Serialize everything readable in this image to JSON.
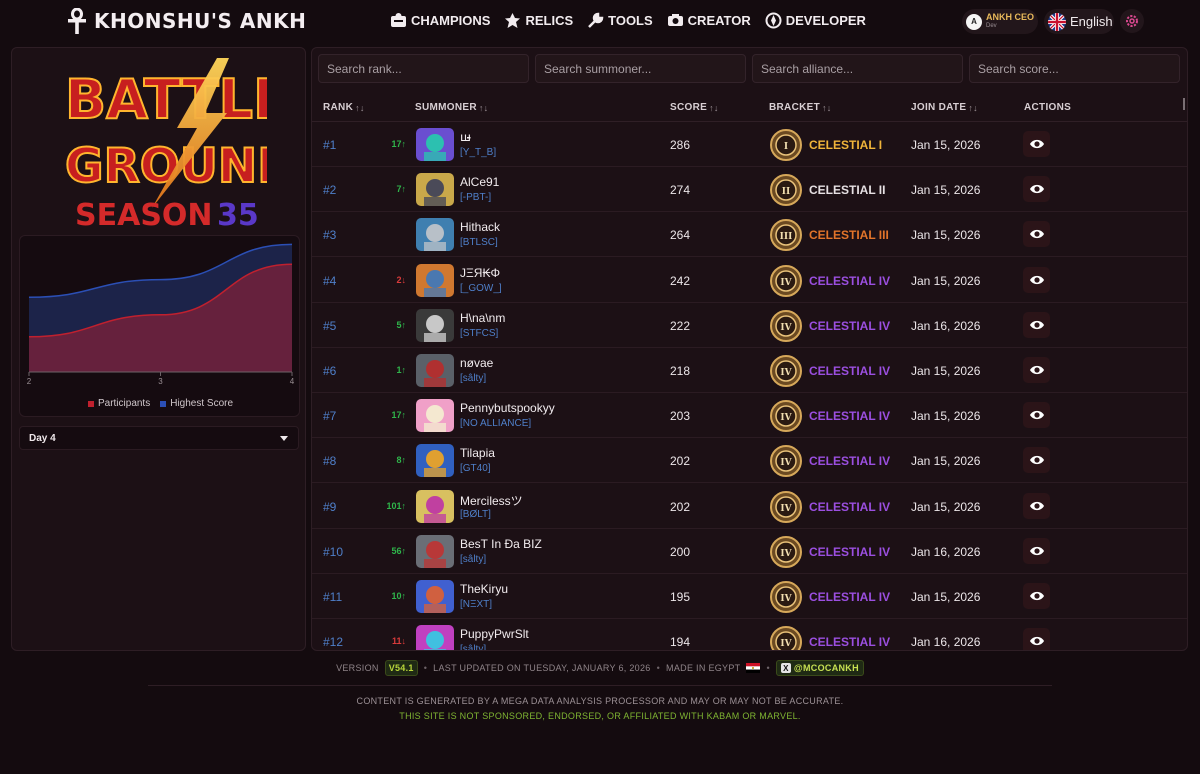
{
  "header": {
    "site_title": "KHONSHU'S ANKH",
    "menu": [
      {
        "label": "CHAMPIONS",
        "icon": "champions-icon"
      },
      {
        "label": "RELICS",
        "icon": "relics-icon"
      },
      {
        "label": "TOOLS",
        "icon": "tools-icon"
      },
      {
        "label": "CREATOR",
        "icon": "creator-icon"
      },
      {
        "label": "DEVELOPER",
        "icon": "developer-icon"
      }
    ],
    "user": {
      "initial": "A",
      "name": "ANKH CEO",
      "role": "Dev"
    },
    "language": "English"
  },
  "sidebar": {
    "logo": {
      "line1": "BATTLE",
      "line2": "GROUNDS",
      "season_word": "SEASON",
      "season_number": "35"
    },
    "day_select": {
      "selected": "Day 4"
    }
  },
  "chart_data": {
    "type": "area",
    "x": [
      2,
      3,
      4
    ],
    "series": [
      {
        "name": "Participants",
        "color": "#c0202e",
        "values": [
          80,
          130,
          245
        ]
      },
      {
        "name": "Highest Score",
        "color": "#2b4fb5",
        "values": [
          170,
          210,
          290
        ]
      }
    ],
    "xlim": [
      2,
      4
    ],
    "ylim": [
      0,
      300
    ],
    "grid": false,
    "legend": "bottom"
  },
  "search": {
    "rank": "Search rank...",
    "summoner": "Search summoner...",
    "alliance": "Search alliance...",
    "score": "Search score..."
  },
  "columns": {
    "rank": "RANK",
    "summoner": "SUMMONER",
    "score": "SCORE",
    "bracket": "BRACKET",
    "join_date": "JOIN DATE",
    "actions": "ACTIONS",
    "sort_glyph": "↑↓"
  },
  "rows": [
    {
      "rank": "#1",
      "delta": "17↑",
      "dir": "up",
      "name": "ꟺ̵̵̵̵̵̵̵̵̵̵̵̵̵̵̵̵̵̵̵̵̵̵̵̵̵̵̵̵̵̵",
      "alliance": "[Y_T_B]",
      "score": "286",
      "bracket": "CELESTIAL I",
      "tier": "I",
      "bracket_color": "#f0b43a",
      "join": "Jan 15, 2026",
      "avatar": [
        "#6a4ed0",
        "#2cc0b0"
      ]
    },
    {
      "rank": "#2",
      "delta": "7↑",
      "dir": "up",
      "name": "AlCe91",
      "alliance": "[-PBT-]",
      "score": "274",
      "bracket": "CELESTIAL II",
      "tier": "II",
      "bracket_color": "#e6e0e3",
      "join": "Jan 15, 2026",
      "avatar": [
        "#c9a84a",
        "#4a4a58"
      ]
    },
    {
      "rank": "#3",
      "delta": "",
      "dir": "up",
      "name": "Hithack",
      "alliance": "[BTLSC]",
      "score": "264",
      "bracket": "CELESTIAL III",
      "tier": "III",
      "bracket_color": "#e2742a",
      "join": "Jan 15, 2026",
      "avatar": [
        "#3f7fb0",
        "#b8c0c8"
      ]
    },
    {
      "rank": "#4",
      "delta": "2↓",
      "dir": "down",
      "name": "JΞЯ₭Φ",
      "alliance": "[_GOW_]",
      "score": "242",
      "bracket": "CELESTIAL IV",
      "tier": "IV",
      "bracket_color": "#9b4fe0",
      "join": "Jan 15, 2026",
      "avatar": [
        "#d07830",
        "#4a78b0"
      ]
    },
    {
      "rank": "#5",
      "delta": "5↑",
      "dir": "up",
      "name": "H\\na\\nm",
      "alliance": "[STFCS]",
      "score": "222",
      "bracket": "CELESTIAL IV",
      "tier": "IV",
      "bracket_color": "#9b4fe0",
      "join": "Jan 16, 2026",
      "avatar": [
        "#3a3a3a",
        "#c8c8c8"
      ]
    },
    {
      "rank": "#6",
      "delta": "1↑",
      "dir": "up",
      "name": "nøvae",
      "alliance": "[sâlty]",
      "score": "218",
      "bracket": "CELESTIAL IV",
      "tier": "IV",
      "bracket_color": "#9b4fe0",
      "join": "Jan 15, 2026",
      "avatar": [
        "#5a6068",
        "#b03030"
      ]
    },
    {
      "rank": "#7",
      "delta": "17↑",
      "dir": "up",
      "name": "Pennybutspookyy",
      "alliance": "[NO ALLIANCE]",
      "score": "203",
      "bracket": "CELESTIAL IV",
      "tier": "IV",
      "bracket_color": "#9b4fe0",
      "join": "Jan 15, 2026",
      "avatar": [
        "#f0a0c8",
        "#f4e8d0"
      ]
    },
    {
      "rank": "#8",
      "delta": "8↑",
      "dir": "up",
      "name": "Tilapia",
      "alliance": "[GT40]",
      "score": "202",
      "bracket": "CELESTIAL IV",
      "tier": "IV",
      "bracket_color": "#9b4fe0",
      "join": "Jan 15, 2026",
      "avatar": [
        "#3060c0",
        "#e0a030"
      ]
    },
    {
      "rank": "#9",
      "delta": "101↑",
      "dir": "up",
      "name": "Mercilessツ",
      "alliance": "[BØLT]",
      "score": "202",
      "bracket": "CELESTIAL IV",
      "tier": "IV",
      "bracket_color": "#9b4fe0",
      "join": "Jan 15, 2026",
      "avatar": [
        "#d8c060",
        "#c040a0"
      ]
    },
    {
      "rank": "#10",
      "delta": "56↑",
      "dir": "up",
      "name": "BesT In Đa BIZ",
      "alliance": "[sâlty]",
      "score": "200",
      "bracket": "CELESTIAL IV",
      "tier": "IV",
      "bracket_color": "#9b4fe0",
      "join": "Jan 16, 2026",
      "avatar": [
        "#6a6e76",
        "#b83838"
      ]
    },
    {
      "rank": "#11",
      "delta": "10↑",
      "dir": "up",
      "name": "TheKiryu",
      "alliance": "[NΞXT]",
      "score": "195",
      "bracket": "CELESTIAL IV",
      "tier": "IV",
      "bracket_color": "#9b4fe0",
      "join": "Jan 15, 2026",
      "avatar": [
        "#4060d0",
        "#d06040"
      ]
    },
    {
      "rank": "#12",
      "delta": "11↓",
      "dir": "down",
      "name": "PuppyPwrSlt",
      "alliance": "[sâlty]",
      "score": "194",
      "bracket": "CELESTIAL IV",
      "tier": "IV",
      "bracket_color": "#9b4fe0",
      "join": "Jan 16, 2026",
      "avatar": [
        "#c040c0",
        "#40c0e0"
      ]
    }
  ],
  "footer": {
    "version_label": "VERSION",
    "version": "V54.1",
    "updated": "LAST UPDATED ON TUESDAY, JANUARY 6, 2026",
    "made_in": "MADE IN EGYPT",
    "flag_emoji": "🇪🇬",
    "x_handle": "@MCOCANKH",
    "disclaimer": "CONTENT IS GENERATED BY A MEGA DATA ANALYSIS PROCESSOR AND MAY OR MAY NOT BE ACCURATE.",
    "affiliation": "THIS SITE IS NOT SPONSORED, ENDORSED, OR AFFILIATED WITH KABAM OR MARVEL."
  }
}
